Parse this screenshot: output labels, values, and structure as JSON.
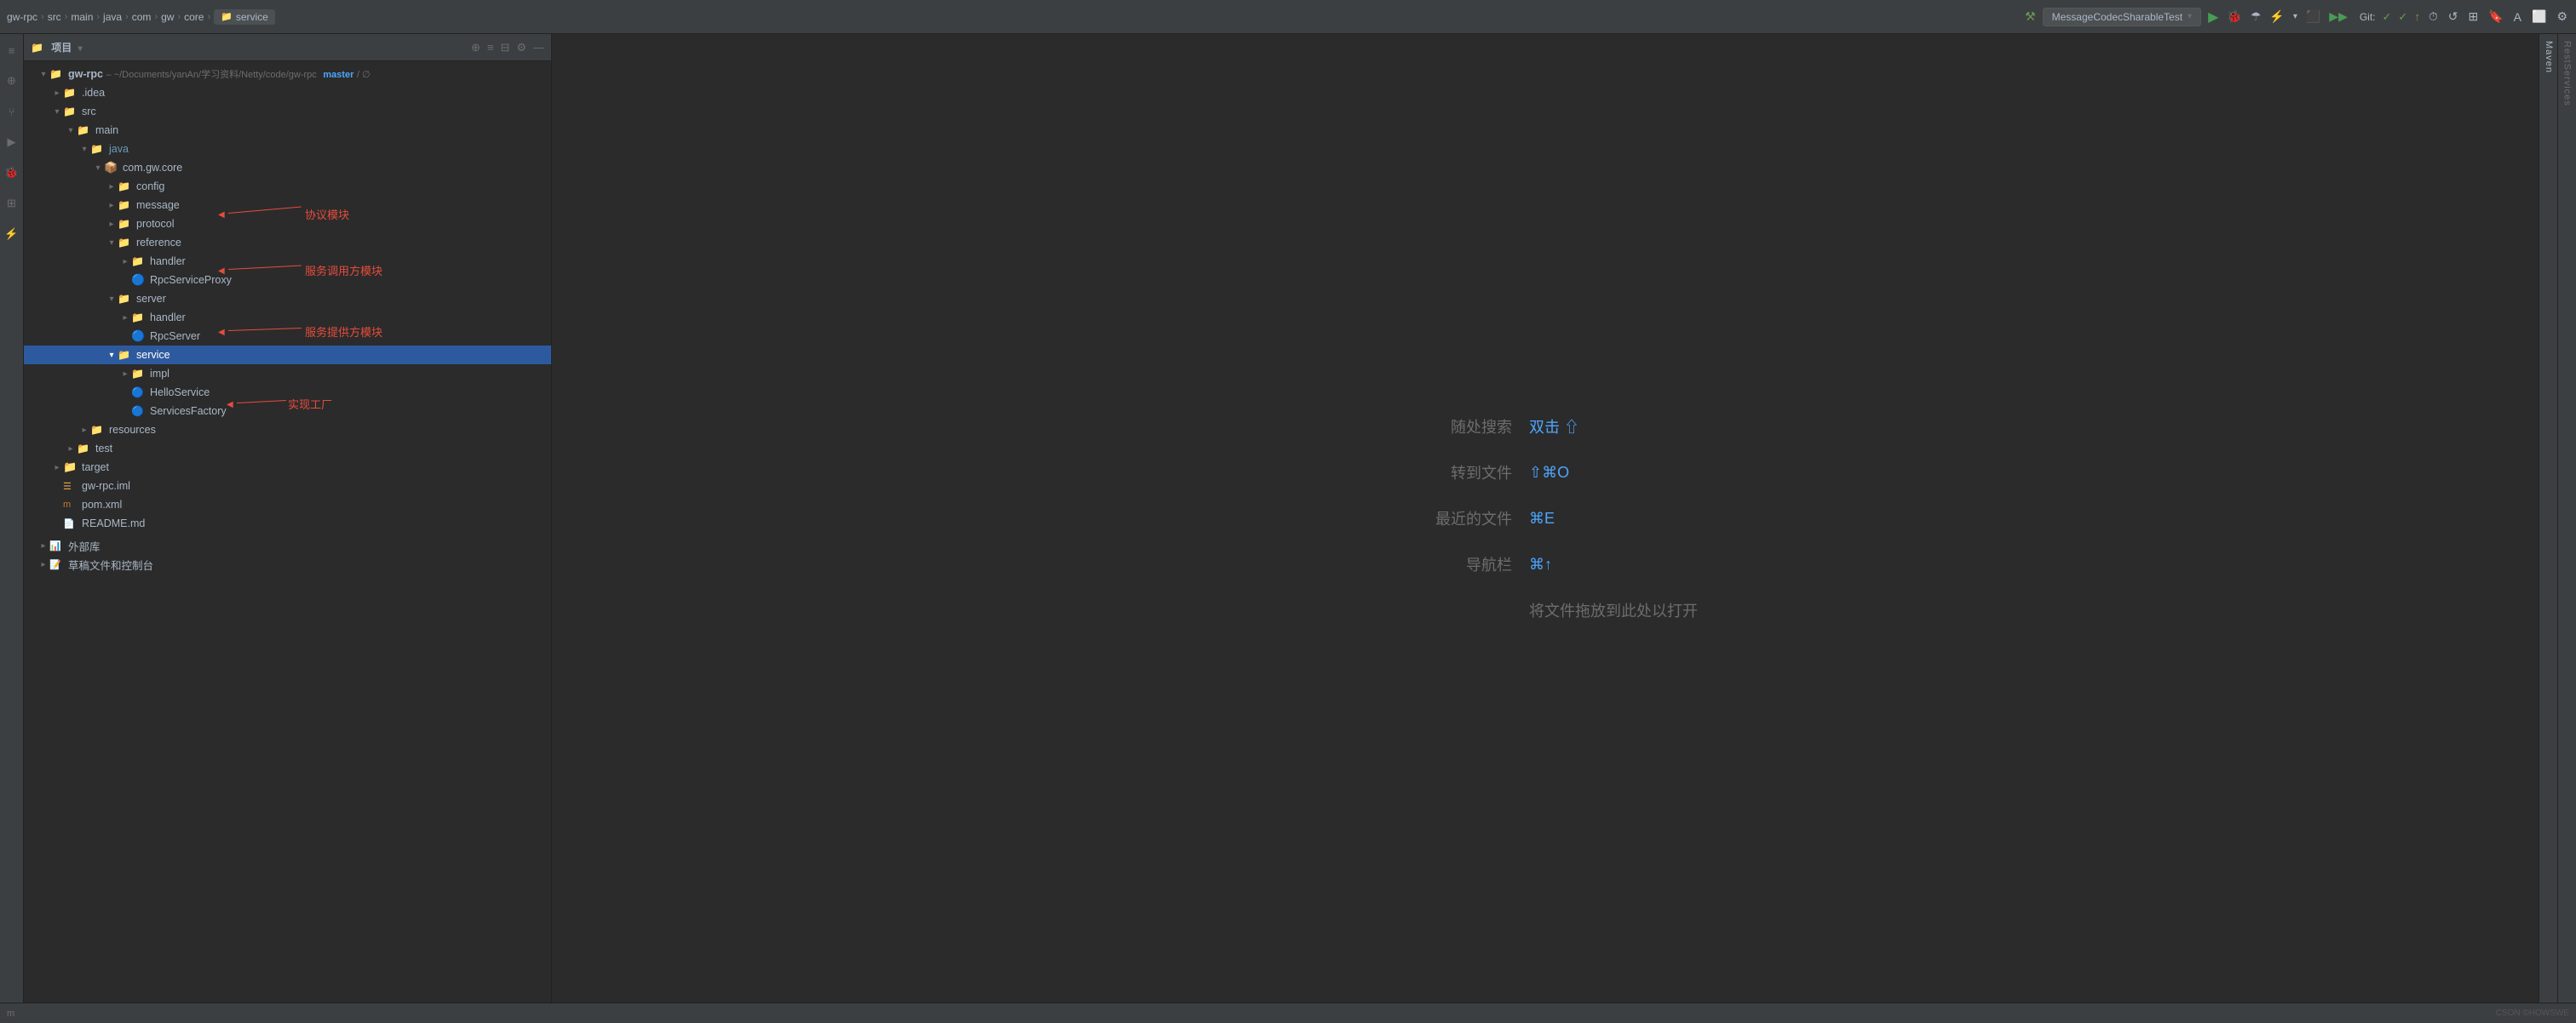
{
  "toolbar": {
    "breadcrumb": [
      "gw-rpc",
      "src",
      "main",
      "java",
      "com",
      "gw",
      "core",
      "service"
    ],
    "run_config": "MessageCodecSharableTest",
    "git_label": "Git:",
    "icons": {
      "run": "▶",
      "debug": "🐛",
      "build": "🔨",
      "reload": "↻"
    }
  },
  "panel": {
    "title": "项目",
    "root_label": "gw-rpc",
    "root_path": "~/Documents/yanAn/学习资料/Netty/code/gw-rpc",
    "branch": "master"
  },
  "tree": {
    "items": [
      {
        "id": "idea",
        "label": ".idea",
        "type": "folder",
        "indent": 2,
        "state": "closed"
      },
      {
        "id": "src",
        "label": "src",
        "type": "folder",
        "indent": 2,
        "state": "open"
      },
      {
        "id": "main",
        "label": "main",
        "type": "folder",
        "indent": 3,
        "state": "open"
      },
      {
        "id": "java",
        "label": "java",
        "type": "folder-blue",
        "indent": 4,
        "state": "open"
      },
      {
        "id": "com.gw.core",
        "label": "com.gw.core",
        "type": "package",
        "indent": 5,
        "state": "open"
      },
      {
        "id": "config",
        "label": "config",
        "type": "folder",
        "indent": 6,
        "state": "closed"
      },
      {
        "id": "message",
        "label": "message",
        "type": "folder",
        "indent": 6,
        "state": "closed"
      },
      {
        "id": "protocol",
        "label": "protocol",
        "type": "folder",
        "indent": 6,
        "state": "closed"
      },
      {
        "id": "reference",
        "label": "reference",
        "type": "folder",
        "indent": 6,
        "state": "open"
      },
      {
        "id": "ref-handler",
        "label": "handler",
        "type": "folder",
        "indent": 7,
        "state": "closed"
      },
      {
        "id": "rpc-proxy",
        "label": "RpcServiceProxy",
        "type": "java-service",
        "indent": 7,
        "state": "leaf"
      },
      {
        "id": "server",
        "label": "server",
        "type": "folder",
        "indent": 6,
        "state": "open"
      },
      {
        "id": "srv-handler",
        "label": "handler",
        "type": "folder",
        "indent": 7,
        "state": "closed"
      },
      {
        "id": "rpc-server",
        "label": "RpcServer",
        "type": "java-rpc",
        "indent": 7,
        "state": "leaf"
      },
      {
        "id": "service",
        "label": "service",
        "type": "folder",
        "indent": 6,
        "state": "open",
        "selected": true
      },
      {
        "id": "impl",
        "label": "impl",
        "type": "folder",
        "indent": 7,
        "state": "closed"
      },
      {
        "id": "hello-service",
        "label": "HelloService",
        "type": "java-iface",
        "indent": 7,
        "state": "leaf"
      },
      {
        "id": "services-factory",
        "label": "ServicesFactory",
        "type": "java-rpc",
        "indent": 7,
        "state": "leaf"
      },
      {
        "id": "resources",
        "label": "resources",
        "type": "folder",
        "indent": 4,
        "state": "closed"
      },
      {
        "id": "test",
        "label": "test",
        "type": "folder",
        "indent": 3,
        "state": "closed"
      },
      {
        "id": "target",
        "label": "target",
        "type": "folder-orange",
        "indent": 2,
        "state": "closed"
      },
      {
        "id": "gw-rpc-iml",
        "label": "gw-rpc.iml",
        "type": "iml",
        "indent": 2,
        "state": "leaf"
      },
      {
        "id": "pom-xml",
        "label": "pom.xml",
        "type": "xml",
        "indent": 2,
        "state": "leaf"
      },
      {
        "id": "readme",
        "label": "README.md",
        "type": "md",
        "indent": 2,
        "state": "leaf"
      }
    ]
  },
  "external_libs": "外部库",
  "scratch_files": "草稿文件和控制台",
  "welcome": {
    "search_label": "随处搜索",
    "search_shortcut": "双击 ⇧",
    "goto_file_label": "转到文件",
    "goto_file_shortcut": "⇧⌘O",
    "recent_label": "最近的文件",
    "recent_shortcut": "⌘E",
    "navbar_label": "导航栏",
    "navbar_shortcut": "⌘↑",
    "drop_label": "将文件拖放到此处以打开"
  },
  "annotations": {
    "protocol": "协议模块",
    "reference": "服务调用方模块",
    "server": "服务提供方模块",
    "service": "实现工厂"
  },
  "right_strip": {
    "label": "RestServices"
  },
  "maven_strip": {
    "label": "Maven"
  },
  "bottom_bar": {
    "left": "m",
    "right": "CSON ©HOWSWE"
  }
}
